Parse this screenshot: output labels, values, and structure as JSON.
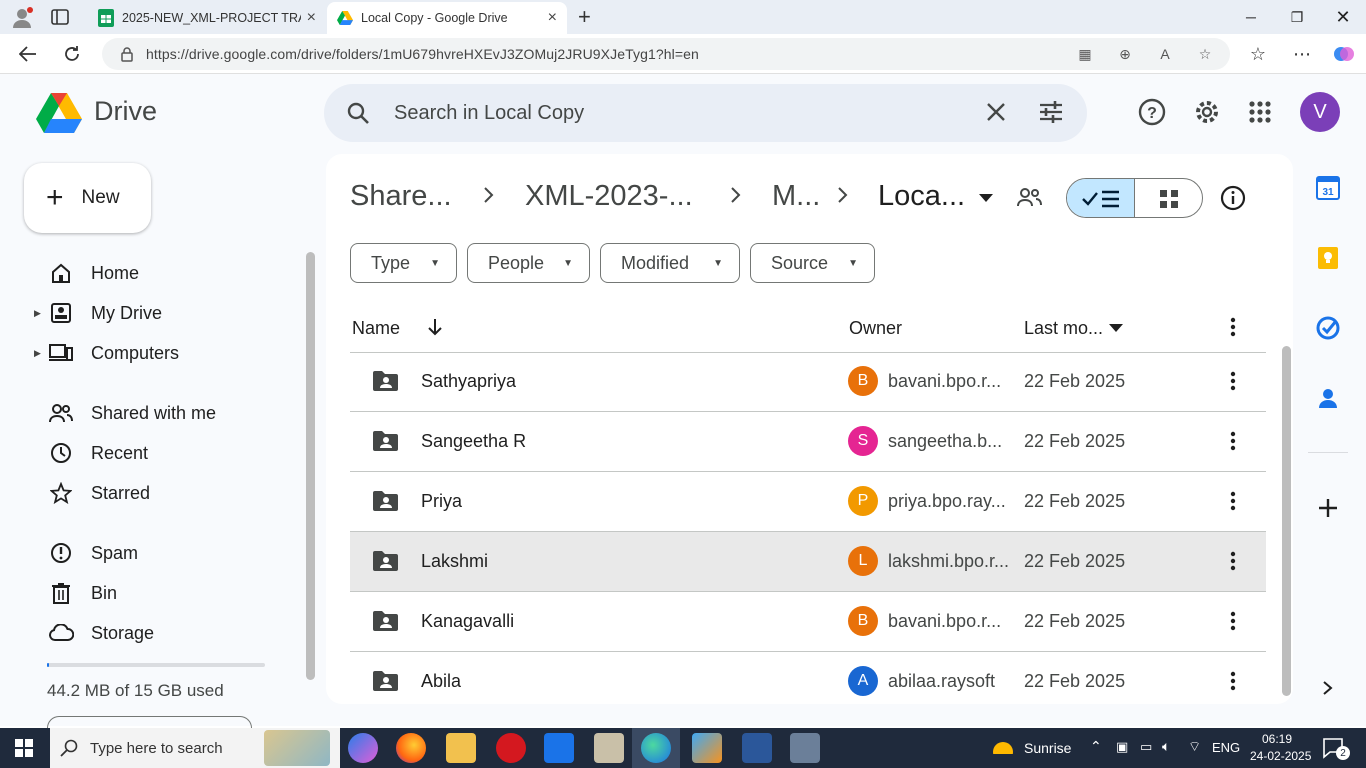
{
  "browser": {
    "tabs": [
      {
        "title": "2025-NEW_XML-PROJECT TRACK",
        "close": "×"
      },
      {
        "title": "Local Copy - Google Drive",
        "close": "×"
      }
    ],
    "new_tab": "+",
    "url": "https://drive.google.com/drive/folders/1mU679hvreHXEvJ3ZOMuj2JRU9XJeTyg1?hl=en"
  },
  "drive": {
    "app_name": "Drive",
    "search_placeholder": "Search in Local Copy",
    "avatar_letter": "V",
    "new_button": "New",
    "nav": [
      {
        "label": "Home",
        "icon": "home-icon"
      },
      {
        "label": "My Drive",
        "icon": "my-drive-icon"
      },
      {
        "label": "Computers",
        "icon": "computers-icon"
      },
      {
        "label": "Shared with me",
        "icon": "shared-icon"
      },
      {
        "label": "Recent",
        "icon": "recent-icon"
      },
      {
        "label": "Starred",
        "icon": "star-icon"
      },
      {
        "label": "Spam",
        "icon": "spam-icon"
      },
      {
        "label": "Bin",
        "icon": "bin-icon"
      },
      {
        "label": "Storage",
        "icon": "cloud-icon"
      }
    ],
    "storage_used_fraction": 0.003,
    "storage_text": "44.2 MB of 15 GB used",
    "breadcrumbs": [
      "Share...",
      "XML-2023-...",
      "M...",
      "Loca..."
    ],
    "filters": [
      "Type",
      "People",
      "Modified",
      "Source"
    ],
    "columns": {
      "name": "Name",
      "owner": "Owner",
      "modified": "Last mo..."
    },
    "rows": [
      {
        "name": "Sathyapriya",
        "owner_initial": "B",
        "owner_color": "#e8710a",
        "owner": "bavani.bpo.r...",
        "date": "22 Feb 2025"
      },
      {
        "name": "Sangeetha R",
        "owner_initial": "S",
        "owner_color": "#e52592",
        "owner": "sangeetha.b...",
        "date": "22 Feb 2025"
      },
      {
        "name": "Priya",
        "owner_initial": "P",
        "owner_color": "#f29900",
        "owner": "priya.bpo.ray...",
        "date": "22 Feb 2025"
      },
      {
        "name": "Lakshmi",
        "owner_initial": "L",
        "owner_color": "#e8710a",
        "owner": "lakshmi.bpo.r...",
        "date": "22 Feb 2025"
      },
      {
        "name": "Kanagavalli",
        "owner_initial": "B",
        "owner_color": "#e8710a",
        "owner": "bavani.bpo.r...",
        "date": "22 Feb 2025"
      },
      {
        "name": "Abila",
        "owner_initial": "A",
        "owner_color": "#1967d2",
        "owner": "abilaa.raysoft",
        "date": "22 Feb 2025"
      }
    ],
    "calendar_day": "31"
  },
  "taskbar": {
    "search_placeholder": "Type here to search",
    "weather": "Sunrise",
    "language": "ENG",
    "time": "06:19",
    "date": "24-02-2025",
    "notifications": "2"
  }
}
